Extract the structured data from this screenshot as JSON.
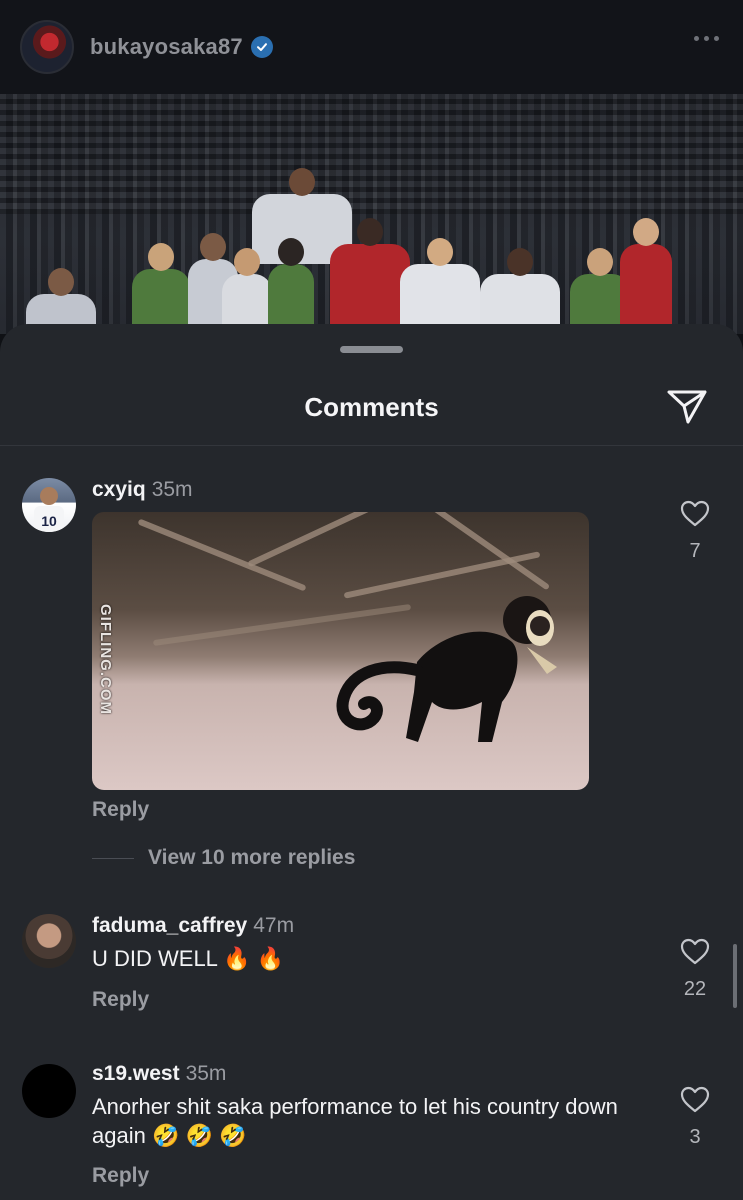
{
  "post": {
    "username": "bukayosaka87",
    "verified_icon": "verified-badge-icon",
    "more_icon": "more-options-icon"
  },
  "sheet": {
    "title": "Comments",
    "share_icon": "send-icon"
  },
  "comments": [
    {
      "username": "cxyiq",
      "time": "35m",
      "text": "",
      "gif_watermark": "GIFLING.COM",
      "reply_label": "Reply",
      "like_count": "7",
      "view_replies": "View 10 more replies"
    },
    {
      "username": "faduma_caffrey",
      "time": "47m",
      "text": "U DID WELL 🔥 🔥",
      "reply_label": "Reply",
      "like_count": "22"
    },
    {
      "username": "s19.west",
      "time": "35m",
      "text": "Anorher shit saka performance to let his country down again 🤣 🤣 🤣",
      "reply_label": "Reply",
      "like_count": "3"
    }
  ],
  "colors": {
    "sheet_bg": "#24272c",
    "text_primary": "#f3f3f5",
    "text_secondary": "#9a9ca2",
    "verified_blue": "#2a6fb1"
  }
}
